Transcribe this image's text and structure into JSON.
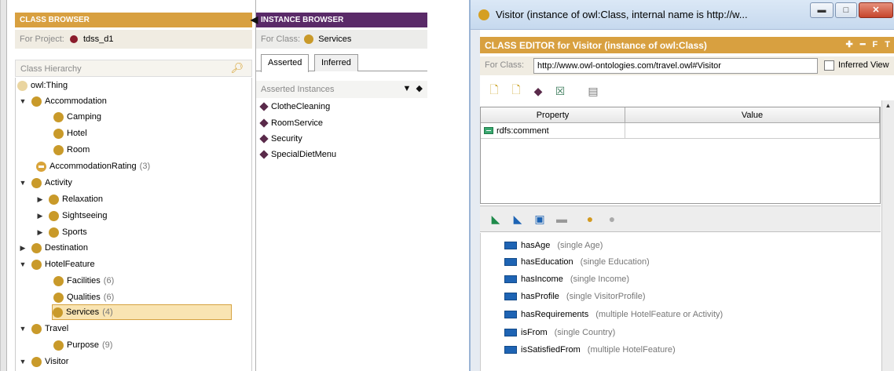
{
  "class_browser": {
    "title": "CLASS BROWSER",
    "for_project_label": "For Project:",
    "project_name": "tdss_d1",
    "hierarchy_label": "Class Hierarchy",
    "tree": [
      {
        "label": "owl:Thing",
        "count": "",
        "toggle": ""
      },
      {
        "label": "Accommodation",
        "count": "",
        "toggle": "▼"
      },
      {
        "label": "Camping",
        "count": "",
        "toggle": ""
      },
      {
        "label": "Hotel",
        "count": "",
        "toggle": ""
      },
      {
        "label": "Room",
        "count": "",
        "toggle": ""
      },
      {
        "label": "AccommodationRating",
        "count": "(3)",
        "toggle": ""
      },
      {
        "label": "Activity",
        "count": "",
        "toggle": "▼"
      },
      {
        "label": "Relaxation",
        "count": "",
        "toggle": "▶"
      },
      {
        "label": "Sightseeing",
        "count": "",
        "toggle": "▶"
      },
      {
        "label": "Sports",
        "count": "",
        "toggle": "▶"
      },
      {
        "label": "Destination",
        "count": "",
        "toggle": "▶"
      },
      {
        "label": "HotelFeature",
        "count": "",
        "toggle": "▼"
      },
      {
        "label": "Facilities",
        "count": "(6)",
        "toggle": ""
      },
      {
        "label": "Qualities",
        "count": "(6)",
        "toggle": ""
      },
      {
        "label": "Services",
        "count": "(4)",
        "toggle": ""
      },
      {
        "label": "Travel",
        "count": "",
        "toggle": "▼"
      },
      {
        "label": "Purpose",
        "count": "(9)",
        "toggle": ""
      },
      {
        "label": "Visitor",
        "count": "",
        "toggle": "▼"
      }
    ]
  },
  "instance_browser": {
    "title": "INSTANCE BROWSER",
    "for_class_label": "For Class:",
    "class_name": "Services",
    "tabs": [
      "Asserted",
      "Inferred"
    ],
    "list_header": "Asserted Instances",
    "instances": [
      "ClotheCleaning",
      "RoomService",
      "Security",
      "SpecialDietMenu"
    ]
  },
  "class_editor": {
    "window_title": "Visitor   (instance of owl:Class, internal name is http://w...",
    "header": "CLASS EDITOR for Visitor   (instance of owl:Class)",
    "header_tools": "✚ ━ F T",
    "for_class_label": "For Class:",
    "for_class_value": "http://www.owl-ontologies.com/travel.owl#Visitor",
    "inferred_view_label": "Inferred View",
    "table_headers": [
      "Property",
      "Value"
    ],
    "table_rows": [
      {
        "property": "rdfs:comment",
        "value": ""
      }
    ],
    "slots": [
      {
        "name": "hasAge",
        "desc": "(single Age)"
      },
      {
        "name": "hasEducation",
        "desc": "(single Education)"
      },
      {
        "name": "hasIncome",
        "desc": "(single Income)"
      },
      {
        "name": "hasProfile",
        "desc": "(single VisitorProfile)"
      },
      {
        "name": "hasRequirements",
        "desc": "(multiple HotelFeature or Activity)"
      },
      {
        "name": "isFrom",
        "desc": "(single Country)"
      },
      {
        "name": "isSatisfiedFrom",
        "desc": "(multiple HotelFeature)"
      }
    ]
  },
  "colors": {
    "class_header": "#d8a040",
    "instance_header": "#5a2a68",
    "class_icon": "#c99a2a",
    "slot_icon": "#1e64b4"
  }
}
